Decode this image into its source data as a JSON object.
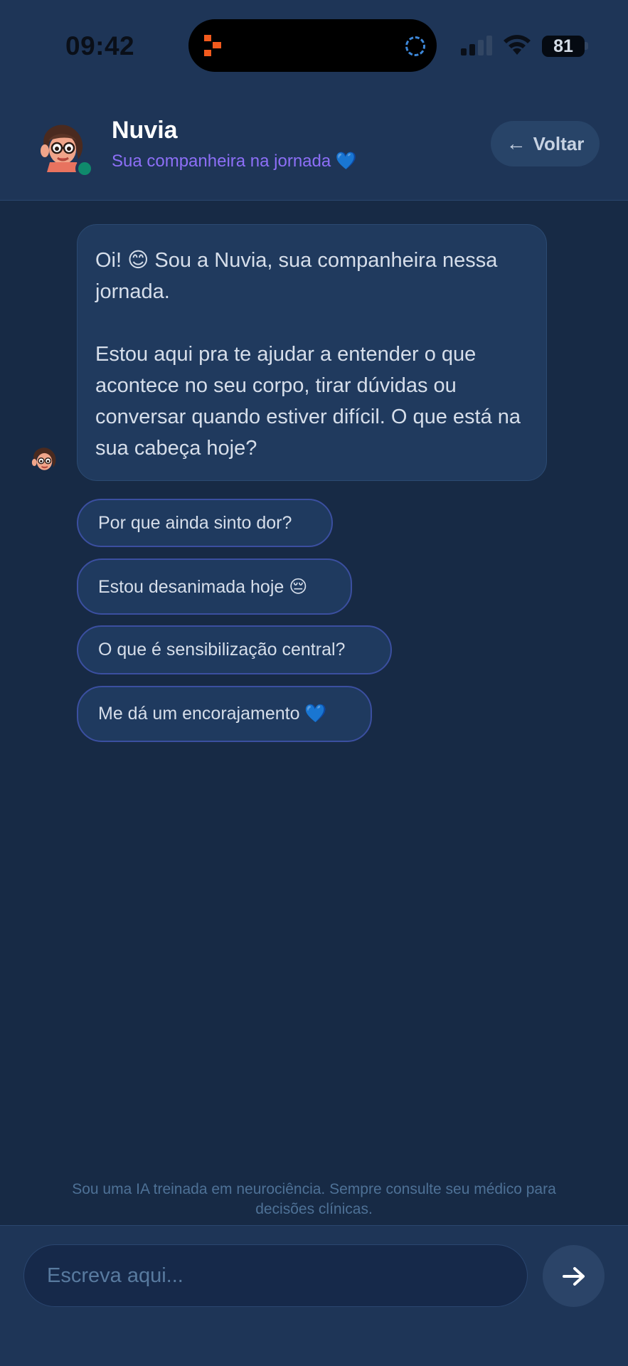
{
  "status_bar": {
    "time": "09:42",
    "battery": "81"
  },
  "header": {
    "name": "Nuvia",
    "subtitle": "Sua companheira na jornada 💙",
    "back_label": "Voltar"
  },
  "messages": [
    {
      "sender": "bot",
      "paragraphs": [
        "Oi! 😊 Sou a Nuvia, sua companheira nessa jornada.",
        "Estou aqui pra te ajudar a entender o que acontece no seu corpo, tirar dúvidas ou conversar quando estiver difícil. O que está na sua cabeça hoje?"
      ]
    }
  ],
  "suggestions": [
    "Por que ainda sinto dor?",
    "Estou desanimada hoje 😔",
    "O que é sensibilização central?",
    "Me dá um encorajamento 💙"
  ],
  "disclaimer": "Sou uma IA treinada em neurociência. Sempre consulte seu médico para decisões clínicas.",
  "composer": {
    "placeholder": "Escreva aqui...",
    "value": ""
  },
  "icons": {
    "back": "arrow-left-icon",
    "send": "arrow-right-icon",
    "avatar": "cartoon-avatar"
  },
  "colors": {
    "background": "#172a45",
    "header": "#1e3557",
    "accent_subtitle": "#8d6ff7",
    "online": "#0f8a6c",
    "chip_border": "#3b4fa0"
  }
}
